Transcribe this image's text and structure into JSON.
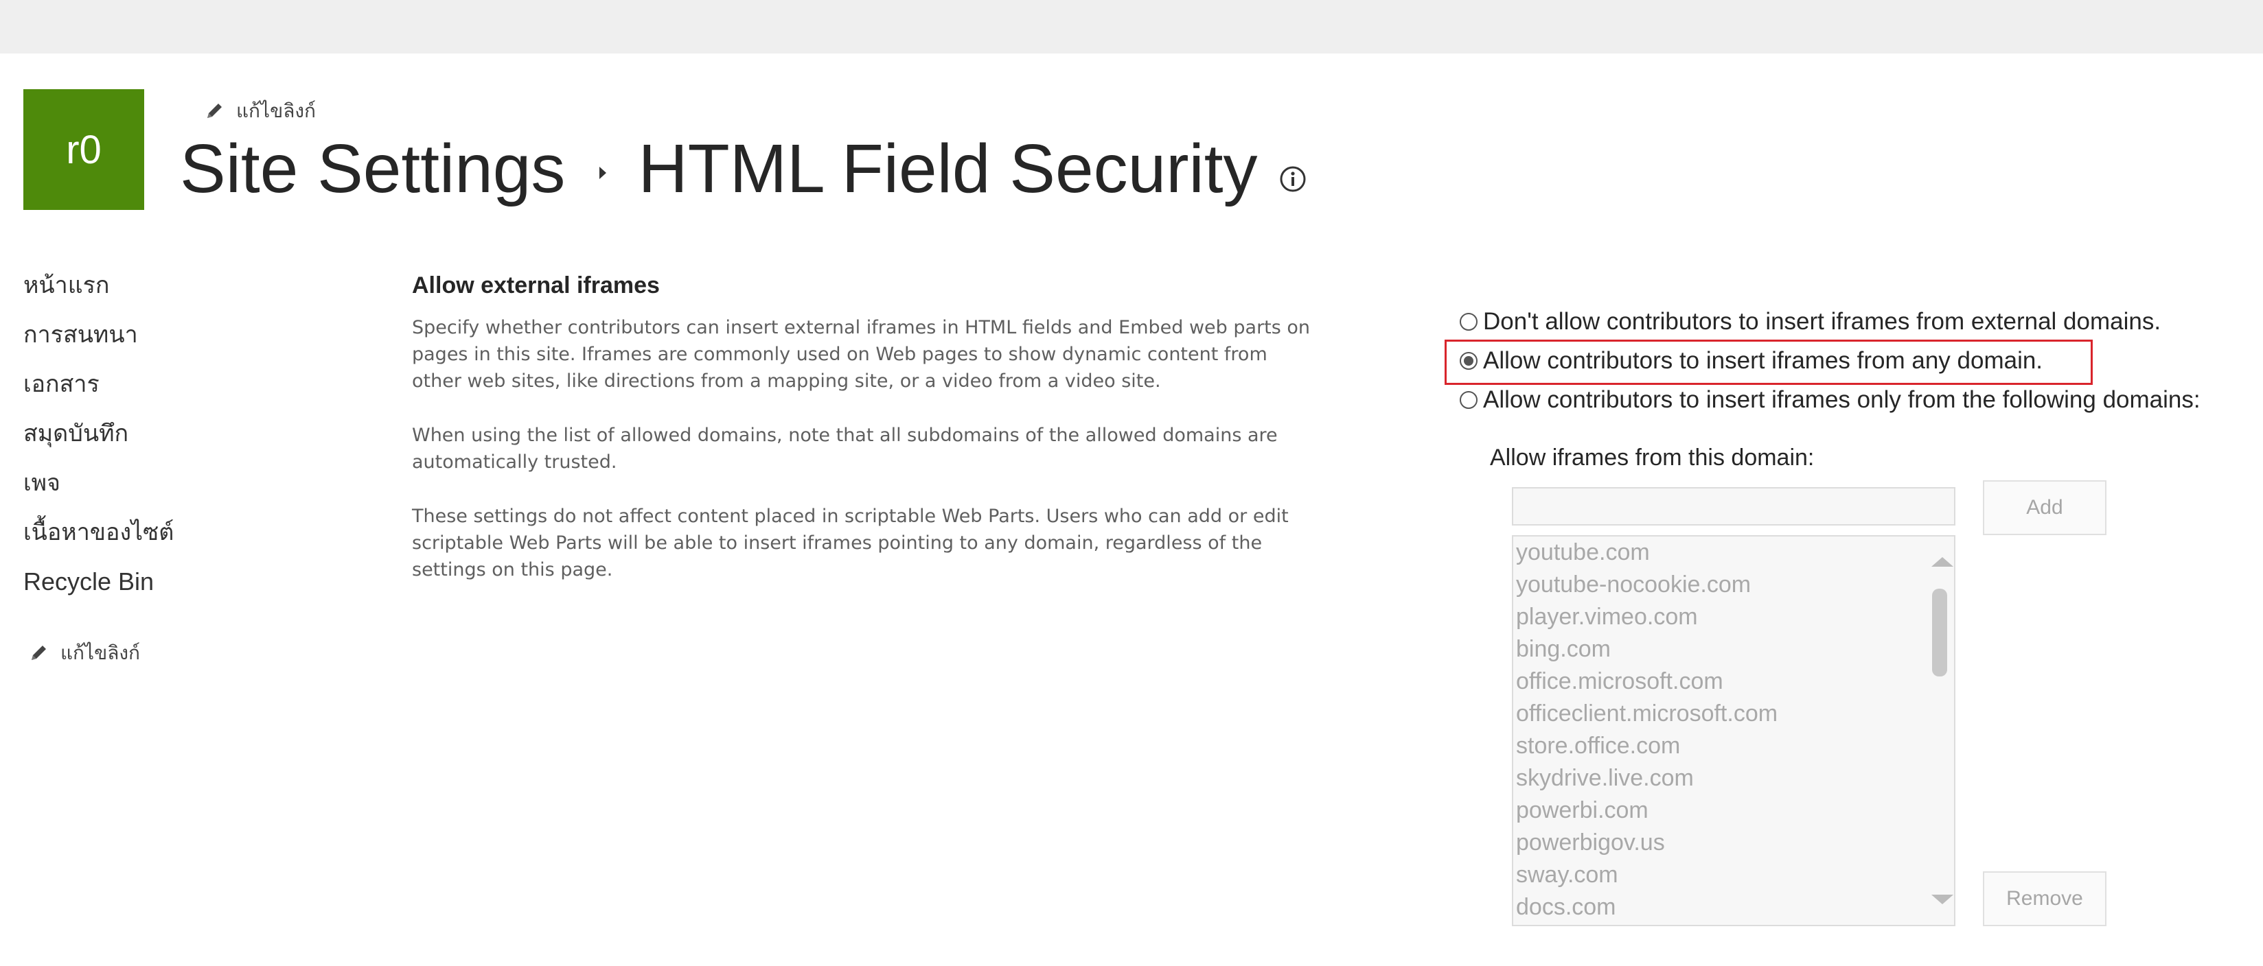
{
  "site": {
    "logo_text": "r0",
    "logo_color": "#4e8a0b",
    "edit_links_label": "แก้ไขลิงก์"
  },
  "breadcrumb": {
    "parent": "Site Settings",
    "current": "HTML Field Security",
    "info_icon": "info-icon"
  },
  "nav": {
    "items": [
      "หน้าแรก",
      "การสนทนา",
      "เอกสาร",
      "สมุดบันทึก",
      "เพจ",
      "เนื้อหาของไซต์",
      "Recycle Bin"
    ],
    "edit_links_label": "แก้ไขลิงก์"
  },
  "section": {
    "title": "Allow external iframes",
    "paragraphs": [
      "Specify whether contributors can insert external iframes in HTML fields and Embed web parts on pages in this site. Iframes are commonly used on Web pages to show dynamic content from other web sites, like directions from a mapping site, or a video from a video site.",
      "When using the list of allowed domains, note that all subdomains of the allowed domains are automatically trusted.",
      "These settings do not affect content placed in scriptable Web Parts. Users who can add or edit scriptable Web Parts will be able to insert iframes pointing to any domain, regardless of the settings on this page."
    ]
  },
  "options": {
    "items": [
      {
        "label": "Don't allow contributors to insert iframes from external domains.",
        "selected": false
      },
      {
        "label": "Allow contributors to insert iframes from any domain.",
        "selected": true
      },
      {
        "label": "Allow contributors to insert iframes only from the following domains:",
        "selected": false
      }
    ],
    "highlight_color": "#d9252c"
  },
  "domains": {
    "label": "Allow iframes from this domain:",
    "input_value": "",
    "add_label": "Add",
    "remove_label": "Remove",
    "list": [
      "youtube.com",
      "youtube-nocookie.com",
      "player.vimeo.com",
      "bing.com",
      "office.microsoft.com",
      "officeclient.microsoft.com",
      "store.office.com",
      "skydrive.live.com",
      "powerbi.com",
      "powerbigov.us",
      "sway.com",
      "docs.com"
    ]
  }
}
